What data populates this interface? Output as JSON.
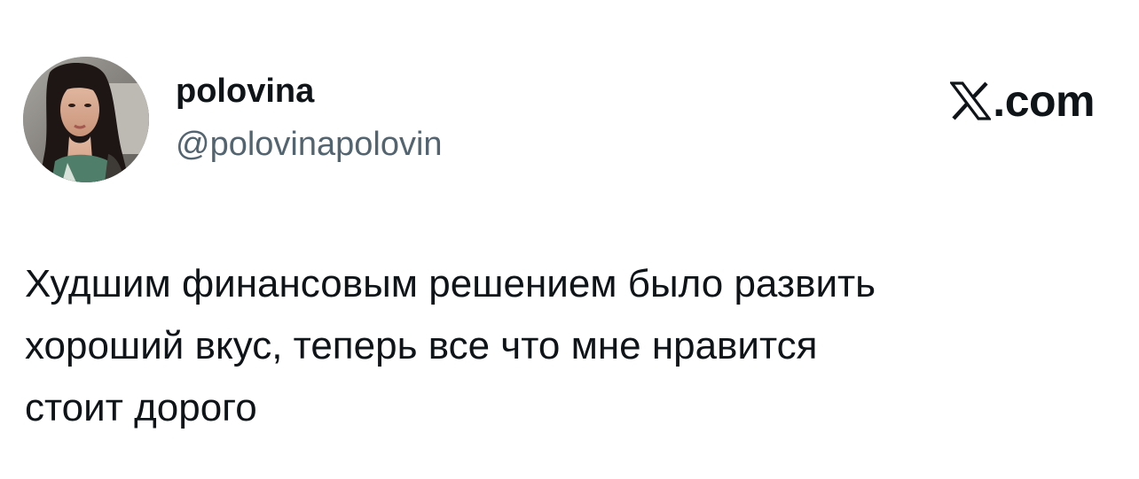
{
  "user": {
    "display_name": "polovina",
    "handle": "@polovinapolovin",
    "avatar_icon": "user-avatar-photo"
  },
  "brand": {
    "logo_icon": "x-logo-icon",
    "text": ".com"
  },
  "tweet": {
    "lines": [
      "Худшим финансовым решением было развить",
      "хороший вкус, теперь все что мне нравится",
      "стоит дорого"
    ]
  },
  "colors": {
    "text_primary": "#0f1419",
    "text_secondary": "#536471",
    "background": "#ffffff"
  }
}
